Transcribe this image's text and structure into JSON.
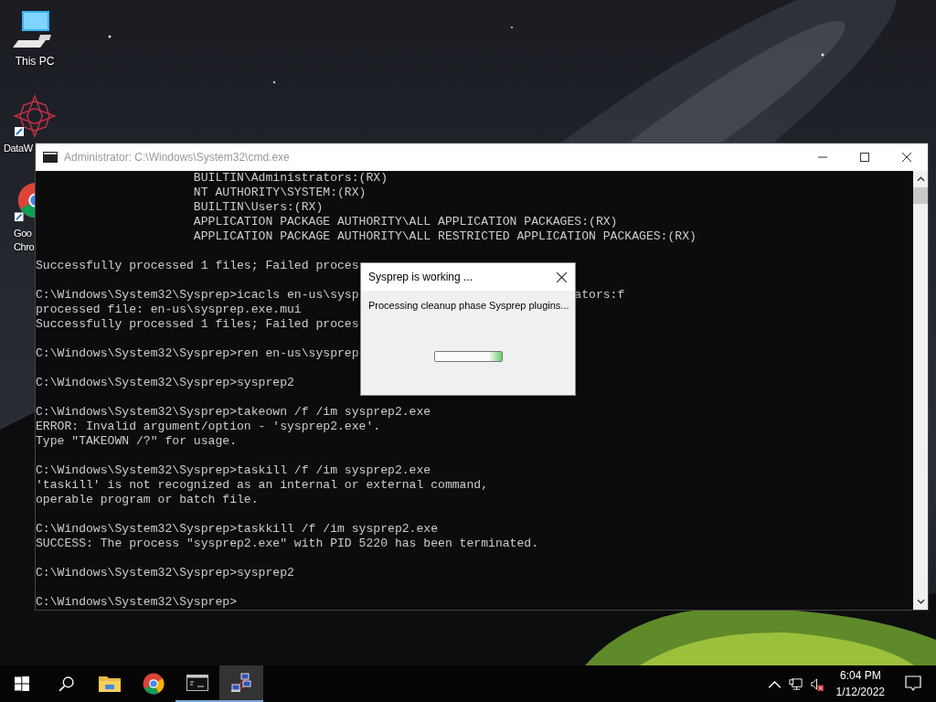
{
  "desktop_icons": [
    {
      "kind": "pc",
      "label_lines": [
        "This PC"
      ]
    },
    {
      "kind": "star",
      "label_lines": [
        "DataW"
      ]
    },
    {
      "kind": "chrome",
      "label_lines": [
        "Goo",
        "Chro"
      ]
    }
  ],
  "console_window": {
    "title": "Administrator: C:\\Windows\\System32\\cmd.exe",
    "lines": [
      {
        "kind": "text",
        "text": "                      BUILTIN\\Administrators:(RX)"
      },
      {
        "kind": "text",
        "text": "                      NT AUTHORITY\\SYSTEM:(RX)"
      },
      {
        "kind": "text",
        "text": "                      BUILTIN\\Users:(RX)"
      },
      {
        "kind": "text",
        "text": "                      APPLICATION PACKAGE AUTHORITY\\ALL APPLICATION PACKAGES:(RX)"
      },
      {
        "kind": "text",
        "text": "                      APPLICATION PACKAGE AUTHORITY\\ALL RESTRICTED APPLICATION PACKAGES:(RX)"
      },
      {
        "kind": "blank"
      },
      {
        "kind": "text",
        "text": "Successfully processed 1 files; Failed proces"
      },
      {
        "kind": "blank"
      },
      {
        "kind": "text",
        "text": "C:\\Windows\\System32\\Sysprep>icacls en-us\\sysp",
        "tail": "ators:f"
      },
      {
        "kind": "text",
        "text": "processed file: en-us\\sysprep.exe.mui"
      },
      {
        "kind": "text",
        "text": "Successfully processed 1 files; Failed proces"
      },
      {
        "kind": "blank"
      },
      {
        "kind": "text",
        "text": "C:\\Windows\\System32\\Sysprep>ren en-us\\sysprep"
      },
      {
        "kind": "blank"
      },
      {
        "kind": "text",
        "text": "C:\\Windows\\System32\\Sysprep>sysprep2"
      },
      {
        "kind": "blank"
      },
      {
        "kind": "text",
        "text": "C:\\Windows\\System32\\Sysprep>takeown /f /im sysprep2.exe"
      },
      {
        "kind": "text",
        "text": "ERROR: Invalid argument/option - 'sysprep2.exe'."
      },
      {
        "kind": "text",
        "text": "Type \"TAKEOWN /?\" for usage."
      },
      {
        "kind": "blank"
      },
      {
        "kind": "text",
        "text": "C:\\Windows\\System32\\Sysprep>taskill /f /im sysprep2.exe"
      },
      {
        "kind": "text",
        "text": "'taskill' is not recognized as an internal or external command,"
      },
      {
        "kind": "text",
        "text": "operable program or batch file."
      },
      {
        "kind": "blank"
      },
      {
        "kind": "text",
        "text": "C:\\Windows\\System32\\Sysprep>taskkill /f /im sysprep2.exe"
      },
      {
        "kind": "text",
        "text": "SUCCESS: The process \"sysprep2.exe\" with PID 5220 has been terminated."
      },
      {
        "kind": "blank"
      },
      {
        "kind": "text",
        "text": "C:\\Windows\\System32\\Sysprep>sysprep2"
      },
      {
        "kind": "blank"
      },
      {
        "kind": "text",
        "text": "C:\\Windows\\System32\\Sysprep>"
      }
    ]
  },
  "dialog": {
    "title": "Sysprep is working ...",
    "message": "Processing cleanup phase Sysprep plugins...",
    "level": 1
  },
  "taskbar": {
    "apps": [
      {
        "kind": "explorer",
        "running": false,
        "selected": false
      },
      {
        "kind": "chrome",
        "running": false,
        "selected": false
      },
      {
        "kind": "console",
        "running": true,
        "selected": false
      },
      {
        "kind": "network",
        "running": true,
        "selected": true
      }
    ],
    "clock": {
      "time": "6:04 PM",
      "date": "1/12/2022"
    }
  }
}
